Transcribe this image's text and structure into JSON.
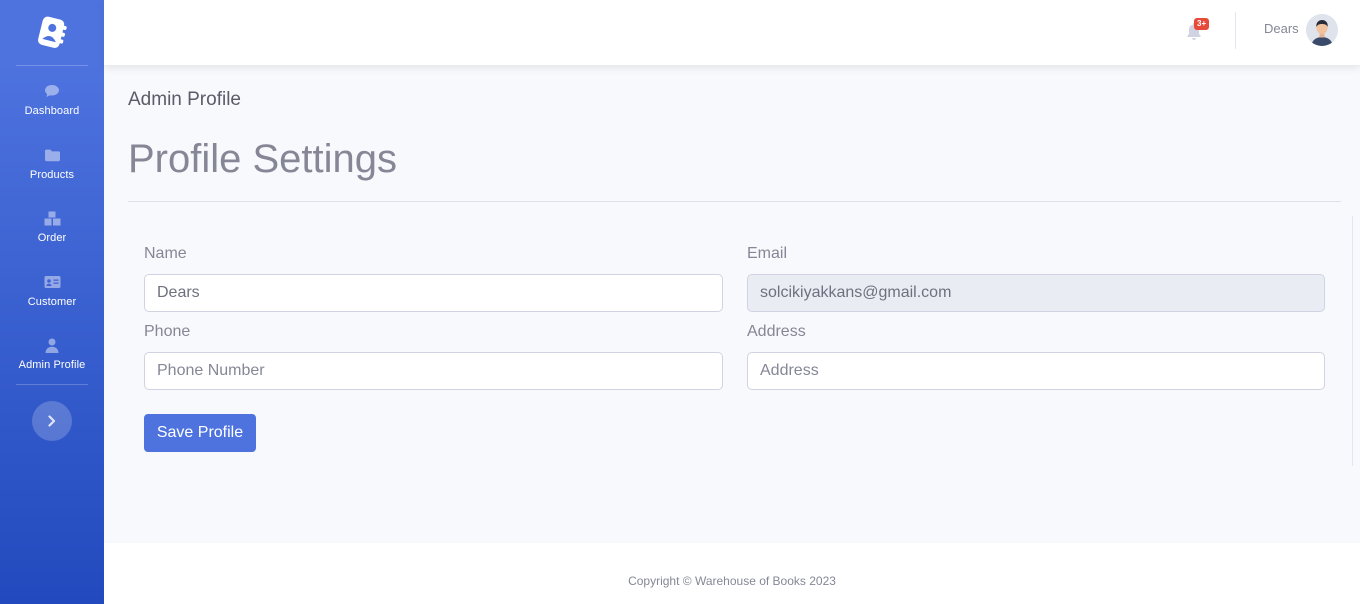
{
  "sidebar": {
    "items": [
      {
        "label": "Dashboard",
        "icon": "comment-icon"
      },
      {
        "label": "Products",
        "icon": "folder-icon"
      },
      {
        "label": "Order",
        "icon": "boxes-icon"
      },
      {
        "label": "Customer",
        "icon": "id-card-icon"
      },
      {
        "label": "Admin Profile",
        "icon": "user-icon"
      }
    ],
    "toggle_icon": "chevron-right-icon"
  },
  "topbar": {
    "notification_count": "3+",
    "user_name": "Dears"
  },
  "page": {
    "breadcrumb": "Admin Profile",
    "title": "Profile Settings"
  },
  "form": {
    "name_label": "Name",
    "name_value": "Dears",
    "email_label": "Email",
    "email_value": "solcikiyakkans@gmail.com",
    "phone_label": "Phone",
    "phone_placeholder": "Phone Number",
    "address_label": "Address",
    "address_placeholder": "Address",
    "save_label": "Save Profile"
  },
  "footer": {
    "copyright": "Copyright © Warehouse of Books 2023"
  },
  "colors": {
    "primary": "#4e73df",
    "sidebar_dark": "#224abe",
    "badge": "#e74a3b"
  }
}
